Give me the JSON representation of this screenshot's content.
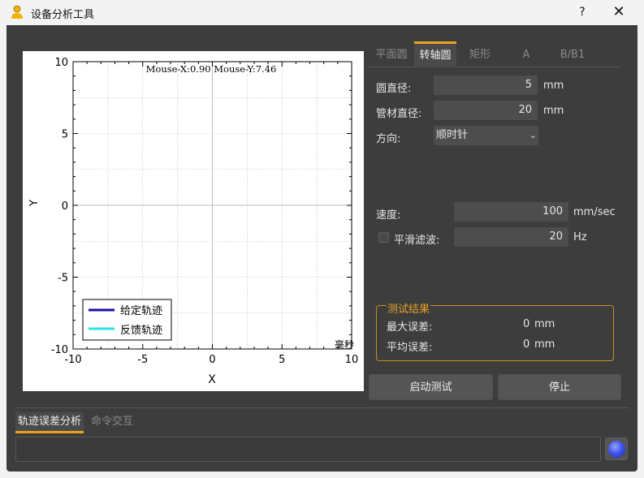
{
  "window": {
    "title": "设备分析工具",
    "help": "?",
    "close": "✕"
  },
  "plot": {
    "mouse_readout": "Mouse-X:0.90 Mouse-Y:7.46",
    "xlabel": "X",
    "ylabel": "Y",
    "corner_label": "毫秒",
    "legend": [
      {
        "name": "给定轨迹",
        "color": "#1a0fa8"
      },
      {
        "name": "反馈轨迹",
        "color": "#28e6e6"
      }
    ]
  },
  "chart_data": {
    "type": "line",
    "x_ticks": [
      "-10",
      "-5",
      "0",
      "5",
      "10"
    ],
    "y_ticks": [
      "10",
      "5",
      "0",
      "-5",
      "-10"
    ],
    "xlim": [
      -10,
      10
    ],
    "ylim": [
      -10,
      10
    ],
    "grid": true,
    "legend_position": "bottom-left",
    "series": [
      {
        "name": "给定轨迹",
        "values": []
      },
      {
        "name": "反馈轨迹",
        "values": []
      }
    ]
  },
  "tabs": [
    "平面圆",
    "转轴圆",
    "矩形",
    "A",
    "B/B1"
  ],
  "form": {
    "circle_diameter": {
      "label": "圆直径:",
      "value": "5",
      "unit": "mm"
    },
    "tube_diameter": {
      "label": "管材直径:",
      "value": "20",
      "unit": "mm"
    },
    "direction": {
      "label": "方向:",
      "value": "顺时针"
    },
    "speed": {
      "label": "速度:",
      "value": "100",
      "unit": "mm/sec"
    },
    "smoothing": {
      "label": "平滑滤波:",
      "value": "20",
      "unit": "Hz"
    }
  },
  "results": {
    "title": "测试结果",
    "max_error": {
      "label": "最大误差:",
      "value": "0",
      "unit": "mm"
    },
    "avg_error": {
      "label": "平均误差:",
      "value": "0",
      "unit": "mm"
    }
  },
  "buttons": {
    "start": "启动测试",
    "stop": "停止"
  },
  "bottom_tabs": [
    "轨迹误差分析",
    "命令交互"
  ]
}
